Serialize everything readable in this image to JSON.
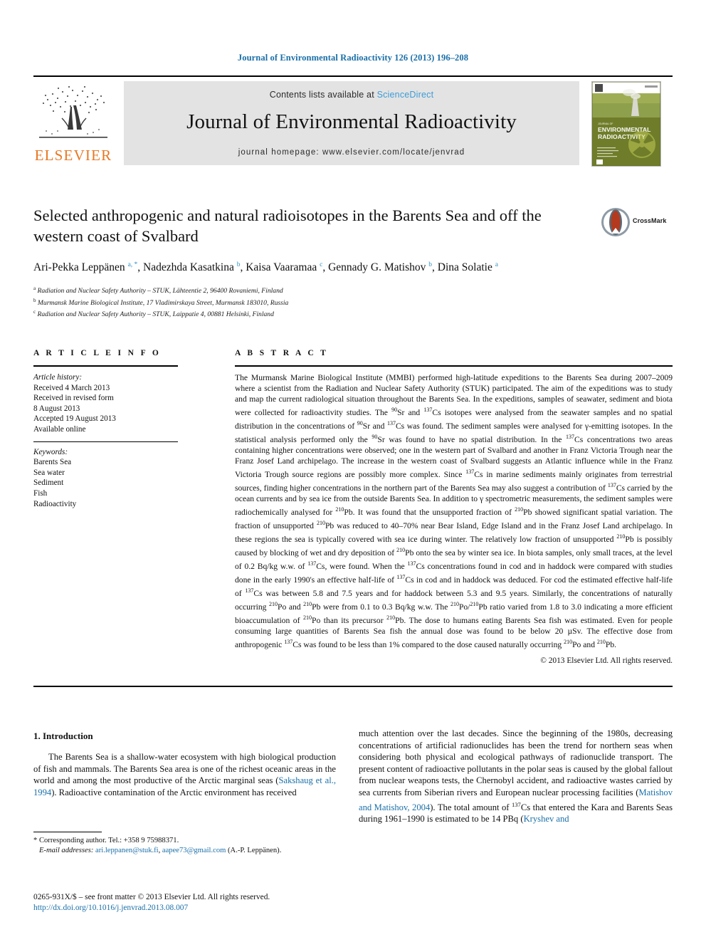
{
  "running_head": "Journal of Environmental Radioactivity 126 (2013) 196–208",
  "masthead": {
    "publisher_name": "ELSEVIER",
    "contents_prefix": "Contents lists available at",
    "sciencedirect": "ScienceDirect",
    "journal_name": "Journal of Environmental Radioactivity",
    "homepage": "journal homepage: www.elsevier.com/locate/jenvrad",
    "cover_title_small": "JOURNAL OF",
    "cover_title_line1": "ENVIRONMENTAL",
    "cover_title_line2": "RADIOACTIVITY"
  },
  "article": {
    "title": "Selected anthropogenic and natural radioisotopes in the Barents Sea and off the western coast of Svalbard",
    "crossmark_label": "CrossMark",
    "authors": "Ari-Pekka Leppänen a, *, Nadezhda Kasatkina b, Kaisa Vaaramaa c, Gennady G. Matishov b, Dina Solatie a",
    "affiliations": [
      {
        "marker": "a",
        "text": "Radiation and Nuclear Safety Authority – STUK, Lähteentie 2, 96400 Rovaniemi, Finland"
      },
      {
        "marker": "b",
        "text": "Murmansk Marine Biological Institute, 17 Vladimirskaya Street, Murmansk 183010, Russia"
      },
      {
        "marker": "c",
        "text": "Radiation and Nuclear Safety Authority – STUK, Laippatie 4, 00881 Helsinki, Finland"
      }
    ]
  },
  "article_info": {
    "heading": "A R T I C L E   I N F O",
    "history_label": "Article history:",
    "history": [
      "Received 4 March 2013",
      "Received in revised form",
      "8 August 2013",
      "Accepted 19 August 2013",
      "Available online"
    ],
    "keywords_label": "Keywords:",
    "keywords": [
      "Barents Sea",
      "Sea water",
      "Sediment",
      "Fish",
      "Radioactivity"
    ]
  },
  "abstract": {
    "heading": "A B S T R A C T",
    "text": "The Murmansk Marine Biological Institute (MMBI) performed high-latitude expeditions to the Barents Sea during 2007–2009 where a scientist from the Radiation and Nuclear Safety Authority (STUK) participated. The aim of the expeditions was to study and map the current radiological situation throughout the Barents Sea. In the expeditions, samples of seawater, sediment and biota were collected for radioactivity studies. The 90Sr and 137Cs isotopes were analysed from the seawater samples and no spatial distribution in the concentrations of 90Sr and 137Cs was found. The sediment samples were analysed for γ-emitting isotopes. In the statistical analysis performed only the 90Sr was found to have no spatial distribution. In the 137Cs concentrations two areas containing higher concentrations were observed; one in the western part of Svalbard and another in Franz Victoria Trough near the Franz Josef Land archipelago. The increase in the western coast of Svalbard suggests an Atlantic influence while in the Franz Victoria Trough source regions are possibly more complex. Since 137Cs in marine sediments mainly originates from terrestrial sources, finding higher concentrations in the northern part of the Barents Sea may also suggest a contribution of 137Cs carried by the ocean currents and by sea ice from the outside Barents Sea. In addition to γ spectrometric measurements, the sediment samples were radiochemically analysed for 210Pb. It was found that the unsupported fraction of 210Pb showed significant spatial variation. The fraction of unsupported 210Pb was reduced to 40–70% near Bear Island, Edge Island and in the Franz Josef Land archipelago. In these regions the sea is typically covered with sea ice during winter. The relatively low fraction of unsupported 210Pb is possibly caused by blocking of wet and dry deposition of 210Pb onto the sea by winter sea ice. In biota samples, only small traces, at the level of 0.2 Bq/kg w.w. of 137Cs, were found. When the 137Cs concentrations found in cod and in haddock were compared with studies done in the early 1990's an effective half-life of 137Cs in cod and in haddock was deduced. For cod the estimated effective half-life of 137Cs was between 5.8 and 7.5 years and for haddock between 5.3 and 9.5 years. Similarly, the concentrations of naturally occurring 210Po and 210Pb were from 0.1 to 0.3 Bq/kg w.w. The 210Po/210Pb ratio varied from 1.8 to 3.0 indicating a more efficient bioaccumulation of 210Po than its precursor 210Pb. The dose to humans eating Barents Sea fish was estimated. Even for people consuming large quantities of Barents Sea fish the annual dose was found to be below 20 μSv. The effective dose from anthropogenic 137Cs was found to be less than 1% compared to the dose caused naturally occurring 210Po and 210Pb.",
    "copyright": "© 2013 Elsevier Ltd. All rights reserved."
  },
  "introduction": {
    "heading": "1.  Introduction",
    "left_paragraph": "The Barents Sea is a shallow-water ecosystem with high biological production of fish and mammals. The Barents Sea area is one of the richest oceanic areas in the world and among the most productive of the Arctic marginal seas (Sakshaug et al., 1994). Radioactive contamination of the Arctic environment has received",
    "left_citation": "Sakshaug et al., 1994",
    "right_paragraph": "much attention over the last decades. Since the beginning of the 1980s, decreasing concentrations of artificial radionuclides has been the trend for northern seas when considering both physical and ecological pathways of radionuclide transport. The present content of radioactive pollutants in the polar seas is caused by the global fallout from nuclear weapons tests, the Chernobyl accident, and radioactive wastes carried by sea currents from Siberian rivers and European nuclear processing facilities (Matishov and Matishov, 2004). The total amount of 137Cs that entered the Kara and Barents Seas during 1961–1990 is estimated to be 14 PBq (Kryshev and",
    "right_citation_1": "Matishov and Matishov, 2004",
    "right_citation_2": "Kryshev and"
  },
  "footnotes": {
    "corresponding": "* Corresponding author. Tel.: +358 9 75988371.",
    "email_label": "E-mail addresses:",
    "email_1": "ari.leppanen@stuk.fi",
    "email_2": "aapee73@gmail.com",
    "email_attrib": "(A.-P. Leppänen).",
    "issn_line": "0265-931X/$ – see front matter © 2013 Elsevier Ltd. All rights reserved.",
    "doi": "http://dx.doi.org/10.1016/j.jenvrad.2013.08.007"
  },
  "colors": {
    "link_blue": "#1a6fa8",
    "sciencedirect_blue": "#3c9cd7",
    "elsevier_orange": "#e87722",
    "banner_gray": "#e3e3e3"
  }
}
